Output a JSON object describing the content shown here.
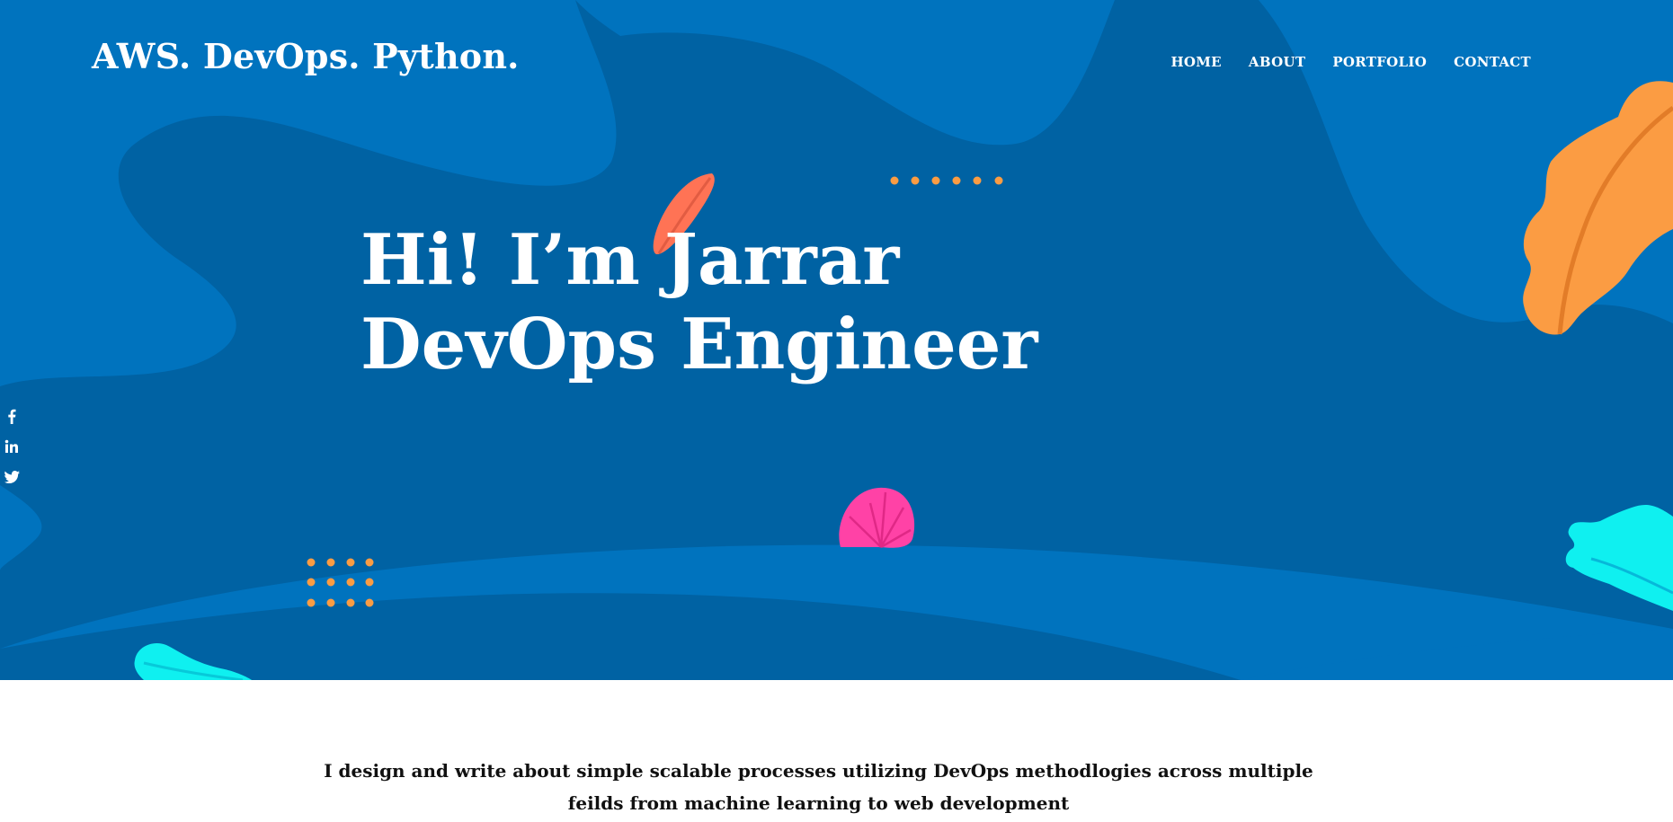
{
  "brand": "AWS. DevOps. Python.",
  "nav": [
    "HOME",
    "ABOUT",
    "PORTFOLIO",
    "CONTACT"
  ],
  "headline": {
    "line1": "Hi! I’m Jarrar",
    "line2": "DevOps Engineer"
  },
  "social": [
    {
      "icon": "facebook-icon",
      "glyph": "f"
    },
    {
      "icon": "linkedin-icon",
      "glyph": "in"
    },
    {
      "icon": "twitter-icon",
      "glyph": "bird"
    }
  ],
  "intro": {
    "line1": "I design and write about simple scalable processes utilizing DevOps methodlogies across multiple",
    "line2": "feilds from machine learning to web development"
  },
  "colors": {
    "hero_dark": "#0062a3",
    "hero_light": "#0073be",
    "orange": "#fb9c43",
    "coral": "#ff7355",
    "pink": "#ff42a6",
    "cyan": "#0ff0f0"
  }
}
